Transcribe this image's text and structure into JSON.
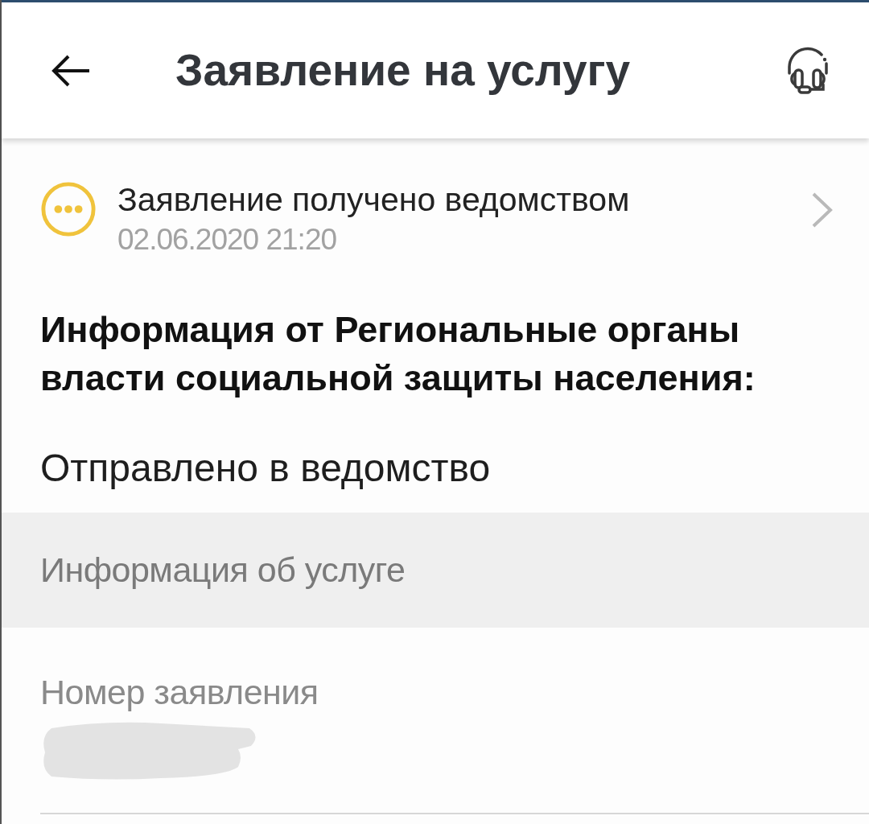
{
  "header": {
    "title": "Заявление на услугу"
  },
  "status": {
    "title": "Заявление получено ведомством",
    "date": "02.06.2020 21:20",
    "color": "#f0c33c"
  },
  "info": {
    "heading": "Информация от Региональные органы власти социальной защиты населения:",
    "text": "Отправлено в ведомство"
  },
  "section": {
    "title": "Информация об услуге"
  },
  "fields": [
    {
      "label": "Номер заявления",
      "redacted": true
    }
  ]
}
